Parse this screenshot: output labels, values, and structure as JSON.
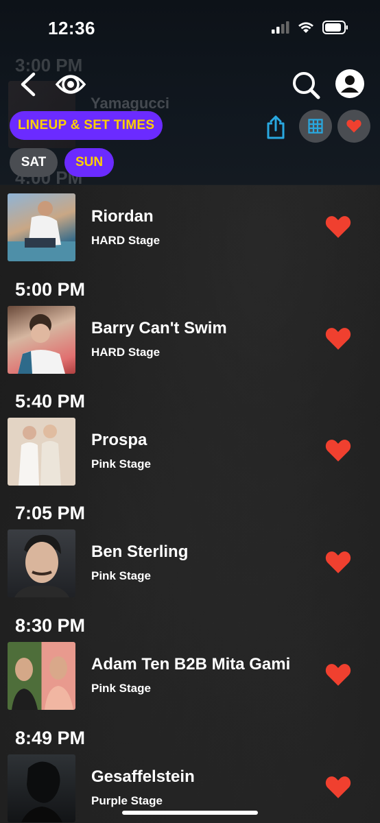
{
  "status_bar": {
    "time": "12:36"
  },
  "header": {
    "ghost_time_1": "3:00 PM",
    "ghost_artist": "Yamagucci",
    "ghost_time_2": "4:00 PM",
    "lineup_label": "LINEUP & SET TIMES",
    "days": [
      "SAT",
      "SUN"
    ],
    "selected_day": "SUN"
  },
  "colors": {
    "accent_purple": "#6b2bff",
    "accent_yellow": "#ffd000",
    "heart_red": "#f0402f",
    "share_blue": "#29a8e0"
  },
  "sets": [
    {
      "time": "",
      "artist": "Riordan",
      "stage": "HARD Stage",
      "favorited": true
    },
    {
      "time": "5:00 PM",
      "artist": "Barry Can't Swim",
      "stage": "HARD Stage",
      "favorited": true
    },
    {
      "time": "5:40 PM",
      "artist": "Prospa",
      "stage": "Pink Stage",
      "favorited": true
    },
    {
      "time": "7:05 PM",
      "artist": "Ben Sterling",
      "stage": "Pink Stage",
      "favorited": true
    },
    {
      "time": "8:30 PM",
      "artist": "Adam Ten B2B Mita Gami",
      "stage": "Pink Stage",
      "favorited": true
    },
    {
      "time": "8:49 PM",
      "artist": "Gesaffelstein",
      "stage": "Purple Stage",
      "favorited": true
    }
  ]
}
